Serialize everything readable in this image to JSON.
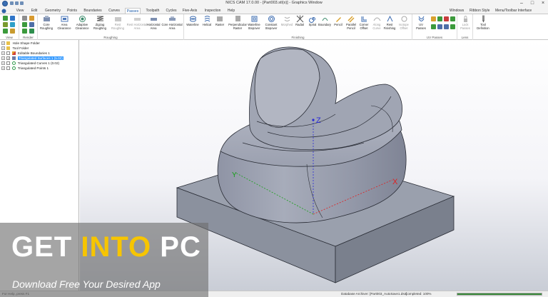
{
  "window": {
    "title": "NICS CAM 17.0.00 - [Part003.stl(x)] - Graphics Window"
  },
  "menu": {
    "app_button_icon": "nics-logo-icon",
    "tabs": [
      "View",
      "Edit",
      "Geometry",
      "Points",
      "Boundaries",
      "Curves",
      "Passes",
      "Toolpath",
      "Cycles",
      "Five-Axis",
      "Inspection",
      "Help"
    ],
    "active_tab": "Passes",
    "right_items": [
      "Windows",
      "Ribbon Style",
      "Menu/Toolbar Interface"
    ]
  },
  "ribbon": {
    "group_labels": {
      "view": "View",
      "render": "Render",
      "roughing": "Roughing",
      "finishing": "Finishing",
      "uv_passes": "UV Passes",
      "lens": "Lens"
    },
    "roughing_buttons": [
      "Core\nRoughing",
      "Area\nClearance",
      "Adaptive\nClearance",
      "Zigzag\nRoughing",
      "Rest\nRoughing",
      "Rest Horizontal\nArea",
      "Horizontal\nArea",
      "Core Horizontal Area"
    ],
    "finishing_buttons": [
      "Waterline",
      "Helical",
      "Raster",
      "Perpendicular\nRaster",
      "Waterline\nStepover",
      "Constant\nStepover",
      "Morphed",
      "Radial",
      "Spiral",
      "Boundary",
      "Pencil",
      "Parallel\nPencil",
      "Corner\nOffset",
      "Along\nCurve",
      "Rest\nFinishing",
      "Isotope\nOffset"
    ],
    "uv_buttons": [
      "UV\nPasses"
    ],
    "lens_buttons": [
      "Lock\nPasses"
    ],
    "tool_button": "Tool\nDefinition"
  },
  "tree": {
    "items": [
      {
        "label": "Hole Shape Folder",
        "icon": "folder-icon"
      },
      {
        "label": "Tool Folder",
        "icon": "folder-icon"
      },
      {
        "label": "Editable Boundaries 1",
        "icon": "boundary-icon"
      },
      {
        "label": "Triangulated Surfaces 1 (5.02)",
        "icon": "surface-icon",
        "selected": true
      },
      {
        "label": "Triangulated Curves 1 (0.02)",
        "icon": "curve-icon"
      },
      {
        "label": "Triangulated Points 1",
        "icon": "points-icon"
      }
    ]
  },
  "viewport": {
    "axis_labels": {
      "z": "Z",
      "x": "X",
      "y": "Y"
    },
    "colors": {
      "model_base": "#8e93a3",
      "model_top": "#aeb3c0",
      "edges": "#2a2d36",
      "z_axis": "#2a2ad6",
      "x_axis": "#e02020",
      "y_axis": "#16a116"
    }
  },
  "status": {
    "help": "For Help, press F1",
    "archiver": "Database Archiver: [Part003_AutoSave1.dsc]",
    "progress": "Completed: 100%",
    "progress_value": 1.0
  },
  "watermark": {
    "line1_a": "GET ",
    "line1_b": "INTO",
    "line1_c": " PC",
    "line2": "Download Free Your Desired App"
  }
}
